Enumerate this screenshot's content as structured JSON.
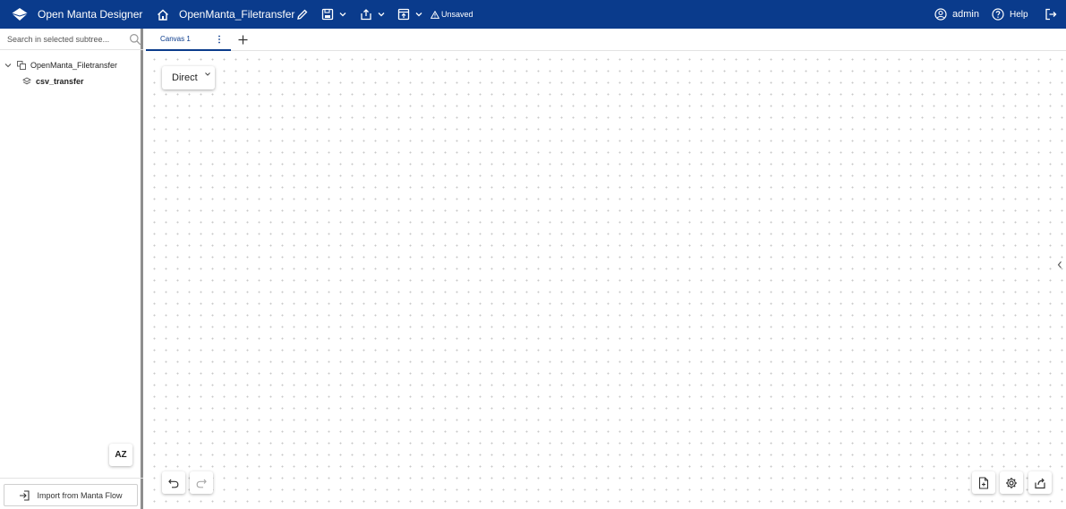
{
  "header": {
    "app_title": "Open Manta Designer",
    "project_name": "OpenManta_Filetransfer",
    "status": "Unsaved",
    "user_name": "admin",
    "help_label": "Help"
  },
  "sidebar": {
    "search_placeholder": "Search in selected subtree...",
    "tree": {
      "root_label": "OpenManta_Filetransfer",
      "child_label": "csv_transfer"
    },
    "sort_label": "AZ",
    "import_label": "Import from Manta Flow"
  },
  "tabs": [
    {
      "label": "Canvas 1",
      "active": true
    }
  ],
  "canvas": {
    "mode_label": "Direct"
  },
  "colors": {
    "header_bg": "#0a3b8c",
    "accent": "#0a3b8c"
  }
}
